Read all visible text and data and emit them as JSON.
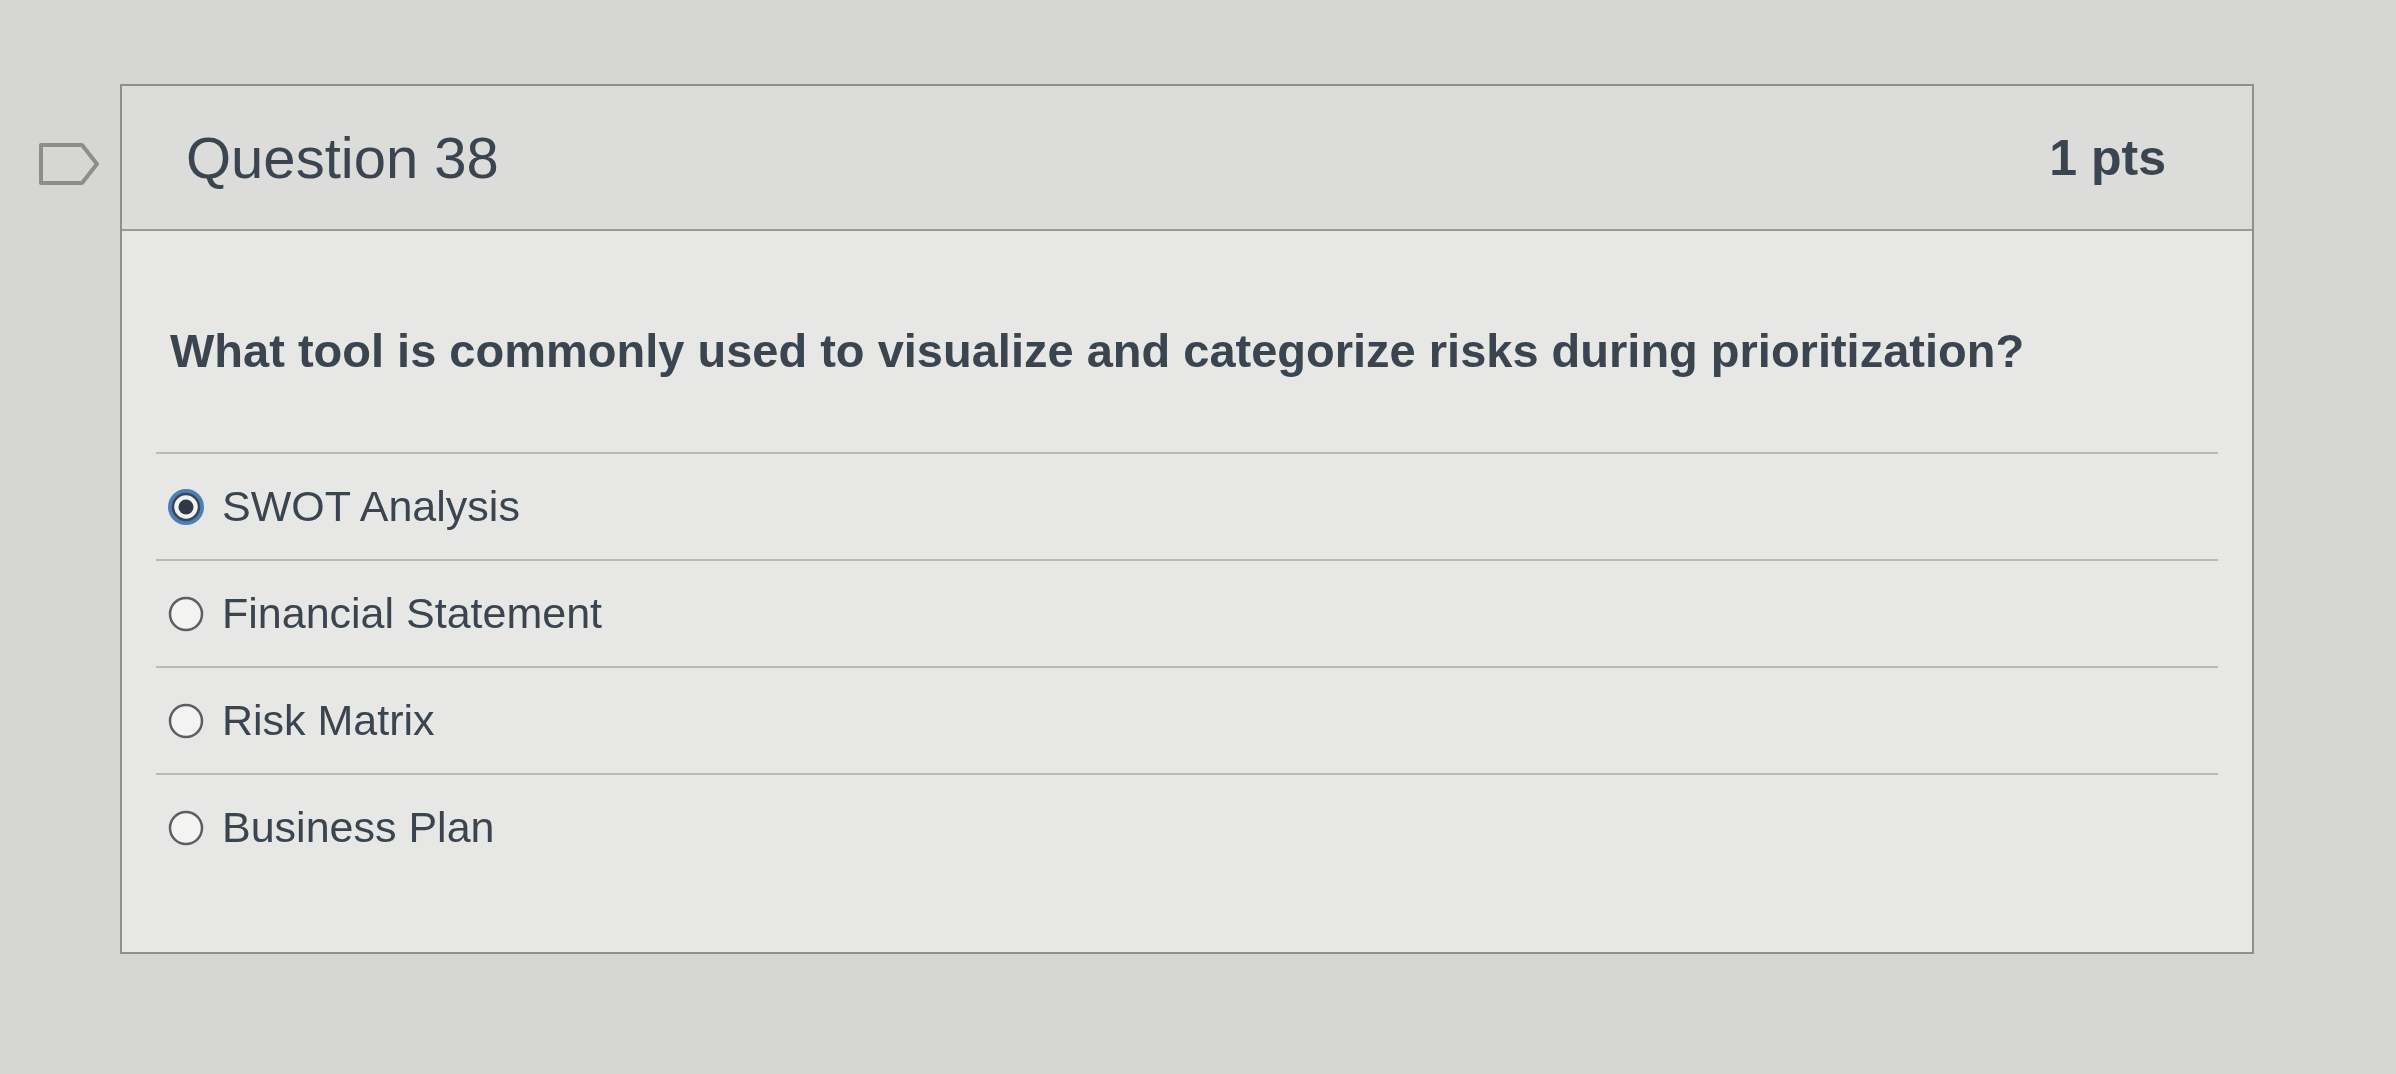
{
  "question": {
    "title": "Question 38",
    "points": "1 pts"
  },
  "prompt": "What tool is commonly used to visualize and categorize risks during prioritization?",
  "answers": [
    {
      "label": "SWOT Analysis",
      "selected": true
    },
    {
      "label": "Financial Statement",
      "selected": false
    },
    {
      "label": "Risk Matrix",
      "selected": false
    },
    {
      "label": "Business Plan",
      "selected": false
    }
  ]
}
